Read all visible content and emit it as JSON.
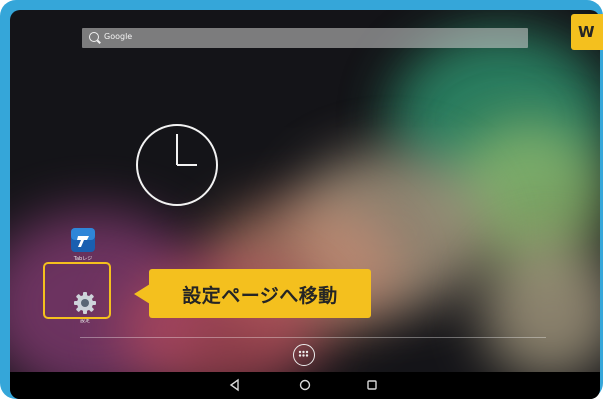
{
  "search": {
    "placeholder": "Google"
  },
  "apps": {
    "tablet_app": {
      "icon": "tablet-app-icon",
      "label": "Tabレジ"
    },
    "settings": {
      "icon": "gear-icon",
      "label": "設定"
    }
  },
  "callout": {
    "text": "設定ページへ移動"
  },
  "corner_tag": {
    "text": "W"
  },
  "colors": {
    "frame": "#35a6d9",
    "accent": "#f4c01e"
  },
  "navbar": {
    "buttons": [
      "back-icon",
      "home-icon",
      "recents-icon"
    ]
  }
}
